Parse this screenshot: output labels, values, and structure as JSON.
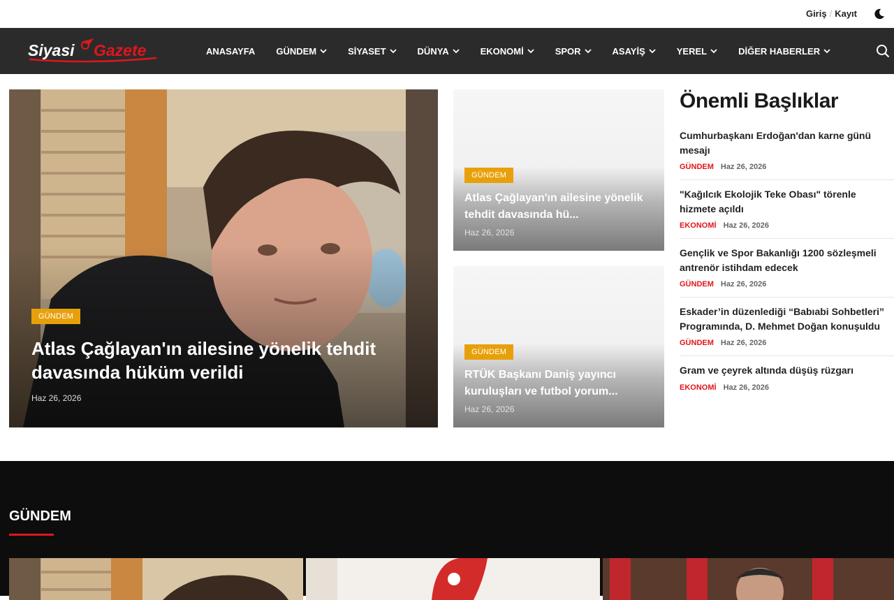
{
  "topbar": {
    "login": "Giriş",
    "register": "Kayıt",
    "dark_mode_icon": "moon-icon"
  },
  "nav": {
    "logo": {
      "part1": "Siyasi",
      "part2": "Gazete"
    },
    "items": [
      {
        "label": "ANASAYFA",
        "dropdown": false
      },
      {
        "label": "GÜNDEM",
        "dropdown": true
      },
      {
        "label": "SİYASET",
        "dropdown": true
      },
      {
        "label": "DÜNYA",
        "dropdown": true
      },
      {
        "label": "EKONOMİ",
        "dropdown": true
      },
      {
        "label": "SPOR",
        "dropdown": true
      },
      {
        "label": "ASAYİŞ",
        "dropdown": true
      },
      {
        "label": "YEREL",
        "dropdown": true
      },
      {
        "label": "DİĞER HABERLER",
        "dropdown": true
      }
    ],
    "search_icon": "search-icon"
  },
  "hero": {
    "category": "GÜNDEM",
    "title": "Atlas Çağlayan'ın ailesine yönelik tehdit davasında hüküm verildi",
    "date": "Haz 26, 2026"
  },
  "cards": [
    {
      "category": "GÜNDEM",
      "title": "Atlas Çağlayan'ın ailesine yönelik tehdit davasında hü...",
      "date": "Haz 26, 2026"
    },
    {
      "category": "GÜNDEM",
      "title": "RTÜK Başkanı Daniş yayıncı kuruluşları ve futbol yorum...",
      "date": "Haz 26, 2026"
    }
  ],
  "side": {
    "title": "Önemli Başlıklar",
    "items": [
      {
        "title": "Cumhurbaşkanı Erdoğan'dan karne günü mesajı",
        "category": "GÜNDEM",
        "date": "Haz 26, 2026"
      },
      {
        "title": "\"Kağılcık Ekolojik Teke Obası\" törenle hizmete açıldı",
        "category": "EKONOMİ",
        "date": "Haz 26, 2026"
      },
      {
        "title": "Gençlik ve Spor Bakanlığı 1200 sözleşmeli antrenör istihdam edecek",
        "category": "GÜNDEM",
        "date": "Haz 26, 2026"
      },
      {
        "title": "Eskader’in düzenlediği “Babıabi Sohbetleri” Programında, D. Mehmet Doğan konuşuldu",
        "category": "GÜNDEM",
        "date": "Haz 26, 2026"
      },
      {
        "title": "Gram ve çeyrek altında düşüş rüzgarı",
        "category": "EKONOMİ",
        "date": "Haz 26, 2026"
      }
    ]
  },
  "section": {
    "title": "GÜNDEM"
  },
  "colors": {
    "accent_red": "#e0161c",
    "badge_yellow": "#e8a00a",
    "nav_bg": "#2b2b2b",
    "dark_bg": "#0d0d0d"
  }
}
